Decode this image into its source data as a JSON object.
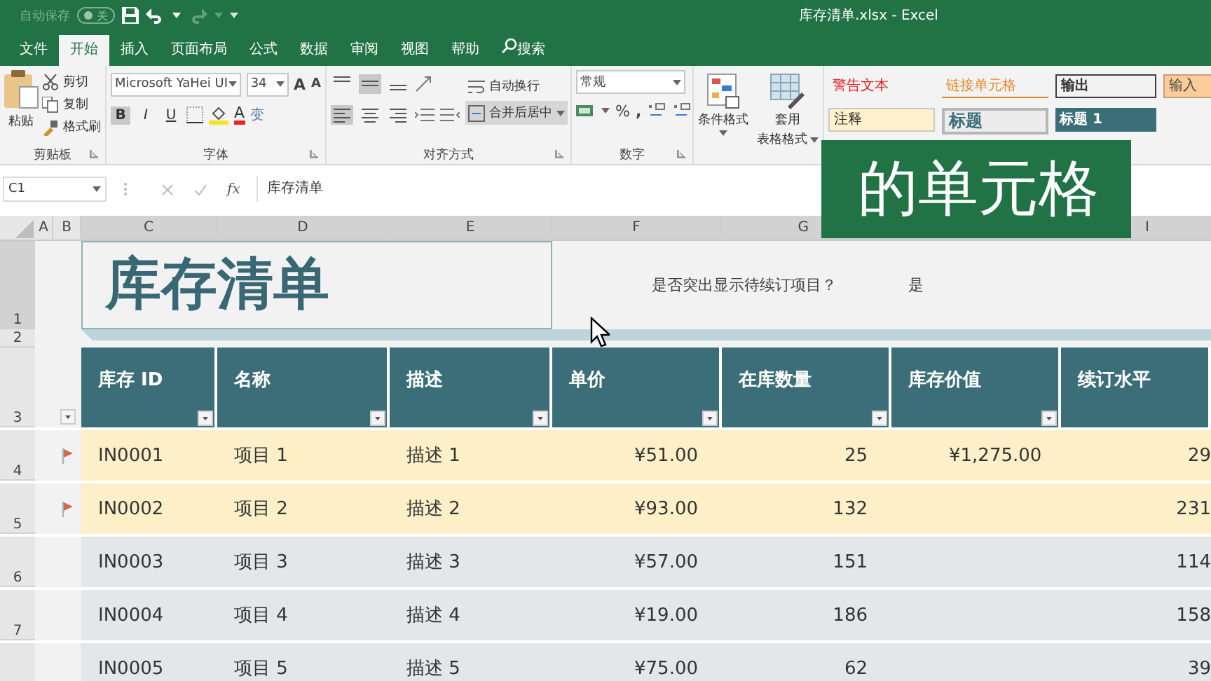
{
  "title_bar": {
    "autosave_label": "自动保存",
    "autosave_state": "关",
    "autosave_on": false,
    "file_title": "库存清单.xlsx - Excel"
  },
  "ribbon_tabs": [
    {
      "label": "文件",
      "selected": false,
      "kind": "tab"
    },
    {
      "label": "开始",
      "selected": true,
      "kind": "tab"
    },
    {
      "label": "插入",
      "selected": false,
      "kind": "tab"
    },
    {
      "label": "页面布局",
      "selected": false,
      "kind": "tab"
    },
    {
      "label": "公式",
      "selected": false,
      "kind": "tab"
    },
    {
      "label": "数据",
      "selected": false,
      "kind": "tab"
    },
    {
      "label": "审阅",
      "selected": false,
      "kind": "tab"
    },
    {
      "label": "视图",
      "selected": false,
      "kind": "tab"
    },
    {
      "label": "帮助",
      "selected": false,
      "kind": "tab"
    },
    {
      "label": "搜索",
      "selected": false,
      "kind": "search"
    }
  ],
  "ribbon": {
    "clipboard": {
      "paste": "粘贴",
      "cut": "剪切",
      "copy": "复制",
      "format_painter": "格式刷",
      "group": "剪贴板"
    },
    "font": {
      "font_name": "Microsoft YaHei UI",
      "font_size": "34",
      "grow": "A",
      "shrink": "A",
      "styles": [
        {
          "label": "B",
          "selected": true
        },
        {
          "label": "I",
          "selected": false
        },
        {
          "label": "U",
          "selected": false
        }
      ],
      "font_color": "A",
      "phonetic": "变",
      "group": "字体"
    },
    "alignment": {
      "vertical": [
        {
          "selected": false
        },
        {
          "selected": true
        },
        {
          "selected": false
        }
      ],
      "horizontal": [
        {
          "selected": true
        },
        {
          "selected": false
        },
        {
          "selected": false
        }
      ],
      "wrap": "自动换行",
      "merge": "合并后居中",
      "merge_on": true,
      "group": "对齐方式"
    },
    "number": {
      "format": "常规",
      "percent": "%",
      "comma": ",",
      "group": "数字"
    },
    "conditional_format": "条件格式",
    "table_format_1": "套用",
    "table_format_2": "表格格式",
    "cell_styles": [
      {
        "label": "警告文本",
        "kind": "warning"
      },
      {
        "label": "链接单元格",
        "kind": "linked"
      },
      {
        "label": "输出",
        "kind": "output"
      },
      {
        "label": "输入",
        "kind": "input"
      },
      {
        "label": "注释",
        "kind": "note"
      },
      {
        "label": "标题",
        "kind": "title"
      },
      {
        "label": "标题 1",
        "kind": "heading1"
      }
    ]
  },
  "formula_bar": {
    "name_box": "C1",
    "function_symbol": "fx",
    "formula": "库存清单"
  },
  "sheet": {
    "columns": [
      "A",
      "B",
      "C",
      "D",
      "E",
      "F",
      "G",
      "I"
    ],
    "row_numbers": [
      "1",
      "2",
      "3",
      "4",
      "5",
      "6",
      "7"
    ],
    "title_cell": "库存清单",
    "prompt": "是否突出显示待续订项目？",
    "prompt_answer": "是",
    "table": {
      "headers": [
        {
          "label": "库存 ID",
          "filter": true
        },
        {
          "label": "名称",
          "filter": true
        },
        {
          "label": "描述",
          "filter": true
        },
        {
          "label": "单价",
          "filter": true
        },
        {
          "label": "在库数量",
          "filter": true
        },
        {
          "label": "库存价值",
          "filter": true
        },
        {
          "label": "续订水平",
          "filter": false
        }
      ],
      "rows": [
        {
          "flagged": true,
          "cells": [
            "IN0001",
            "项目 1",
            "描述 1",
            "¥51.00",
            "25",
            "¥1,275.00",
            "29"
          ]
        },
        {
          "flagged": true,
          "cells": [
            "IN0002",
            "项目 2",
            "描述 2",
            "¥93.00",
            "132",
            "",
            "231"
          ]
        },
        {
          "flagged": false,
          "cells": [
            "IN0003",
            "项目 3",
            "描述 3",
            "¥57.00",
            "151",
            "",
            "114"
          ]
        },
        {
          "flagged": false,
          "cells": [
            "IN0004",
            "项目 4",
            "描述 4",
            "¥19.00",
            "186",
            "",
            "158"
          ]
        },
        {
          "flagged": false,
          "cells": [
            "IN0005",
            "项目 5",
            "描述 5",
            "¥75.00",
            "62",
            "",
            "39"
          ]
        }
      ]
    }
  },
  "overlay_caption": "的单元格"
}
